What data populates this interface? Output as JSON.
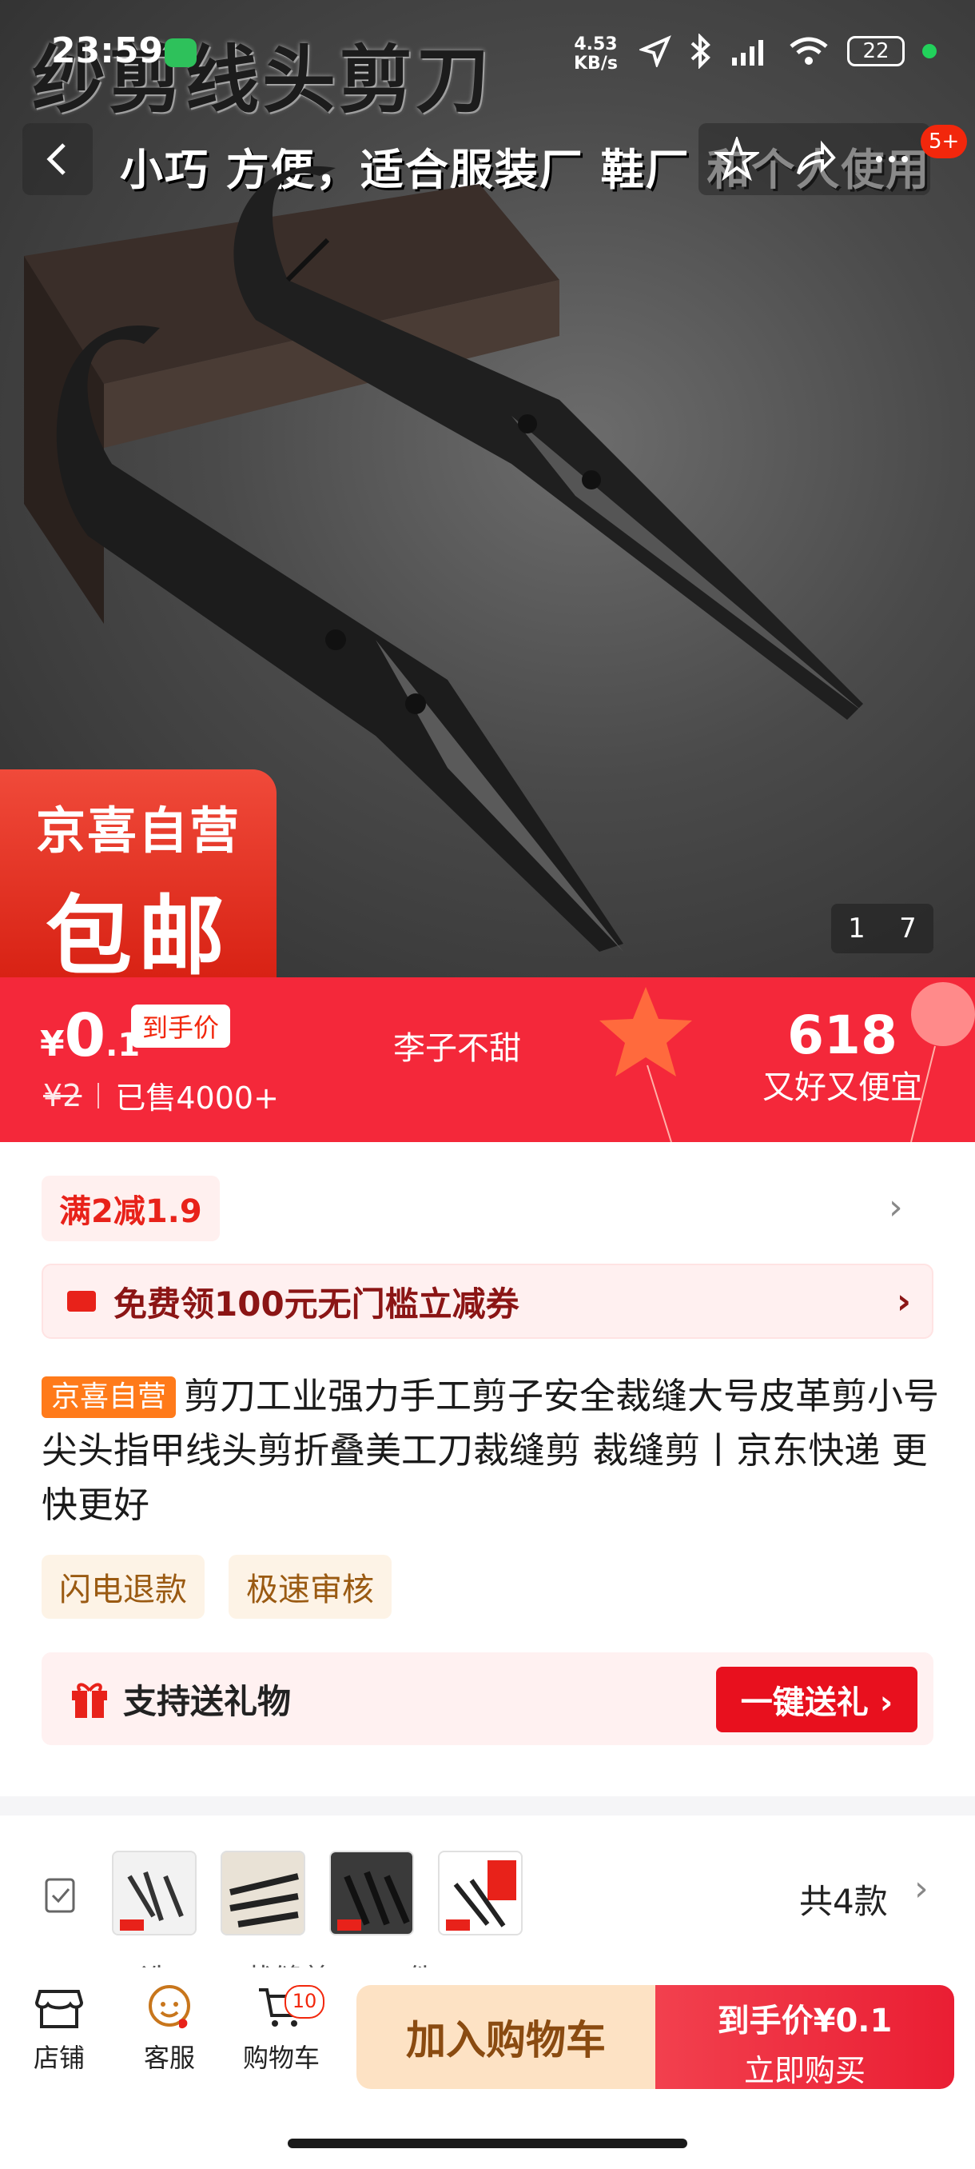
{
  "status_bar": {
    "time": "23:59",
    "net_speed_value": "4.53",
    "net_speed_unit": "KB/s",
    "battery": "22"
  },
  "nav": {
    "badge": "5+"
  },
  "hero": {
    "banner_title": "纱剪线头剪刀",
    "banner_sub": "小巧 方便，适合服装厂 鞋厂 和个人使用",
    "badge_line1": "京喜自营",
    "badge_line2": "包邮",
    "counter_current": "1",
    "counter_total": "7"
  },
  "price": {
    "currency": "¥",
    "integer": "0",
    "decimal": ".1",
    "daoshou_label": "到手价",
    "original": "¥2",
    "sold": "已售4000+",
    "seller": "李子不甜",
    "promo_number": "618",
    "promo_text": "又好又便宜"
  },
  "promotions": {
    "coupon_rule": "满2减1.9",
    "coupon_banner": "免费领100元无门槛立减券"
  },
  "product": {
    "tag": "京喜自营",
    "title": "剪刀工业强力手工剪子安全裁缝大号皮革剪小号尖头指甲线头剪折叠美工刀裁缝剪 裁缝剪丨京东快递 更快更好",
    "chips": [
      "闪电退款",
      "极速审核"
    ]
  },
  "gift": {
    "label": "支持送礼物",
    "button": "一键送礼 ›"
  },
  "variants": {
    "count": "共4款",
    "names_partial": [
      "三选...",
      "裁缝剪...",
      "件..."
    ]
  },
  "bottom_bar": {
    "shop": "店铺",
    "service": "客服",
    "cart": "购物车",
    "cart_badge": "10",
    "add_cart": "加入购物车",
    "buy_line1": "到手价¥0.1",
    "buy_line2": "立即购买"
  },
  "colors": {
    "accent_red": "#f4283a",
    "cart_button_bg": "#fde2c4"
  }
}
